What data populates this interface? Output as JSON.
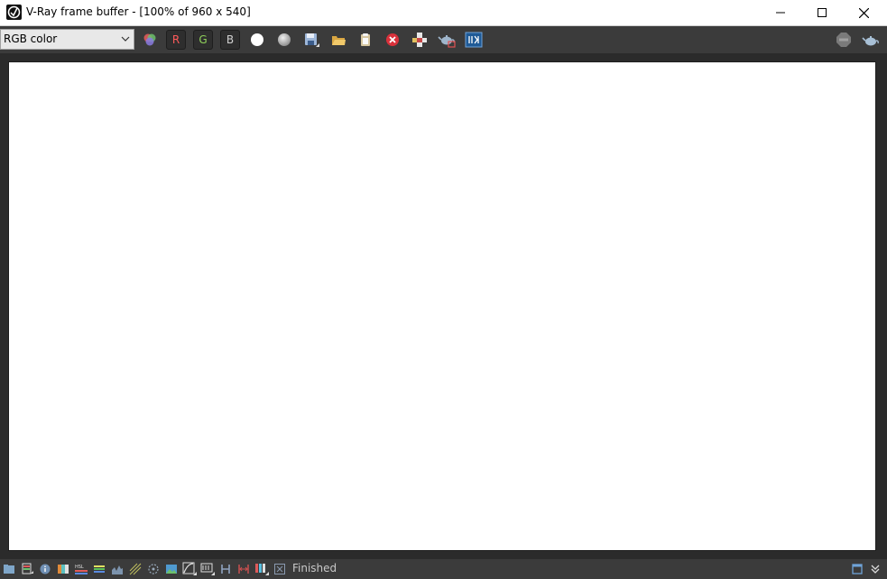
{
  "window": {
    "title": "V-Ray frame buffer - [100% of 960 x 540]",
    "controls": [
      "minimize-icon",
      "maximize-icon",
      "close-icon"
    ]
  },
  "toolbar": {
    "channel_select": {
      "selected": "RGB color"
    },
    "channel_buttons": {
      "r": "R",
      "g": "G",
      "b": "B"
    },
    "icons": [
      "color-mix-icon",
      "white-circle-icon",
      "gray-circle-icon",
      "save-icon",
      "open-folder-icon",
      "clipboard-icon",
      "clear-icon",
      "track-mouse-icon",
      "render-teapot-icon",
      "region-icon",
      "stop-icon",
      "teapot-icon"
    ]
  },
  "statusbar": {
    "status": "Finished",
    "icons": [
      "open-icon",
      "history-icon",
      "info-icon",
      "lut-icon",
      "hsl-icon",
      "levels-icon",
      "curve-icon",
      "lens-icon",
      "grid-icon",
      "image-icon",
      "exposure-icon",
      "timeline-icon",
      "h-icon",
      "stereo-icon",
      "color-bars-icon",
      "crop-icon",
      "panel-icon",
      "expand-icon"
    ]
  },
  "colors": {
    "chrome": "#3b3b3b",
    "background": "#2b2b2b",
    "render": "#ffffff",
    "red_channel": "#ff5a5a",
    "green_channel": "#8fd05a"
  }
}
